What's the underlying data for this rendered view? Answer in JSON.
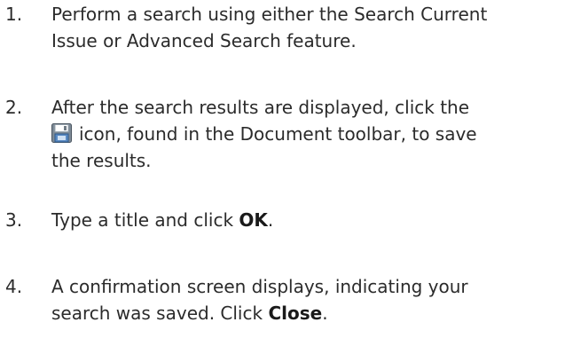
{
  "steps": [
    {
      "number": "1.",
      "lines": [
        "Perform a search using either the Search Current",
        "Issue or Advanced Search feature."
      ]
    },
    {
      "number": "2.",
      "line1": "After the search results are displayed, click the",
      "line2_after_icon": "icon, found in the Document toolbar, to save",
      "line3": "the results.",
      "icon": "save-disk-icon"
    },
    {
      "number": "3.",
      "prefix": "Type a title and click ",
      "bold": "OK",
      "suffix": "."
    },
    {
      "number": "4.",
      "line1": "A confirmation screen displays, indicating your",
      "line2_prefix": "search was saved. Click ",
      "line2_bold": "Close",
      "line2_suffix": "."
    }
  ]
}
